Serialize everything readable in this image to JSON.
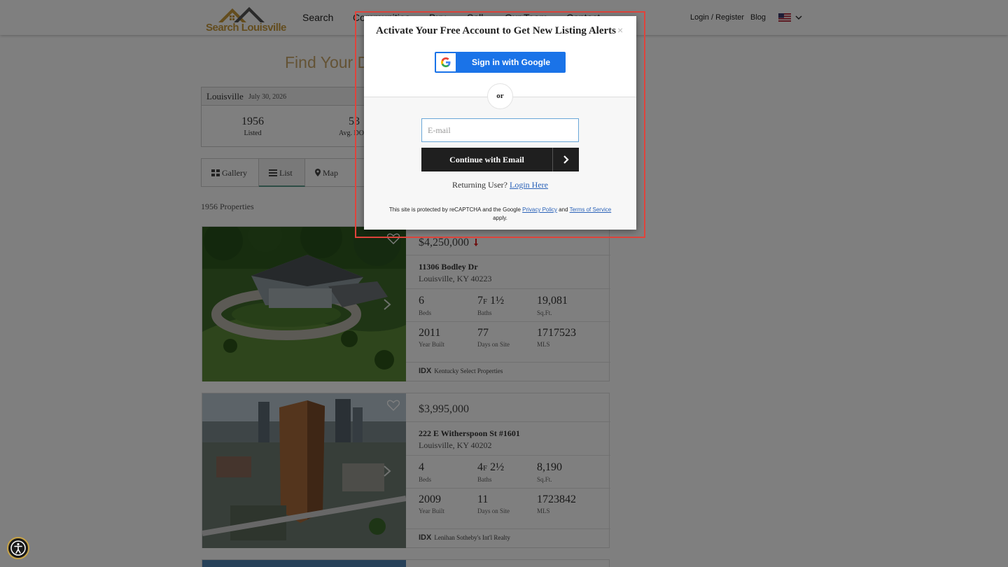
{
  "header": {
    "logo_text": "Search Louisville",
    "nav": [
      "Search",
      "Communities",
      "Buy",
      "Sell",
      "Our Team",
      "Contact"
    ],
    "login_register": "Login / Register",
    "blog": "Blog",
    "language_icon": "us-flag-icon"
  },
  "page": {
    "heading": "Find Your D",
    "stats": {
      "city": "Louisville",
      "date": "July 30, 2026",
      "listed_value": "1956",
      "listed_label": "Listed",
      "dom_value": "53",
      "dom_label": "Avg. DO"
    },
    "view_tabs": [
      "Gallery",
      "List",
      "Map"
    ],
    "property_count": "1956 Properties"
  },
  "listings": [
    {
      "price": "$4,250,000",
      "price_change_icon": "arrow-down-icon",
      "street": "11306 Bodley Dr",
      "city_state_zip": "Louisville, KY 40223",
      "beds": "6",
      "beds_label": "Beds",
      "baths_full": "7",
      "baths_full_suffix": "F",
      "baths_half": "1½",
      "baths_label": "Baths",
      "sqft": "19,081",
      "sqft_label": "Sq.Ft.",
      "year_built": "2011",
      "year_built_label": "Year Built",
      "days_on_site": "77",
      "days_on_site_label": "Days on Site",
      "mls": "1717523",
      "mls_label": "MLS",
      "idx_label": "IDX",
      "brokerage": "Kentucky Select Properties"
    },
    {
      "price": "$3,995,000",
      "street": "222 E Witherspoon St #1601",
      "city_state_zip": "Louisville, KY 40202",
      "beds": "4",
      "beds_label": "Beds",
      "baths_full": "4",
      "baths_full_suffix": "F",
      "baths_half": "2½",
      "baths_label": "Baths",
      "sqft": "8,190",
      "sqft_label": "Sq.Ft.",
      "year_built": "2009",
      "year_built_label": "Year Built",
      "days_on_site": "11",
      "days_on_site_label": "Days on Site",
      "mls": "1723842",
      "mls_label": "MLS",
      "idx_label": "IDX",
      "brokerage": "Lenihan Sotheby's Int'l Realty"
    }
  ],
  "modal": {
    "title": "Activate Your Free Account to Get New Listing Alerts",
    "close": "×",
    "google_button": "Sign in with Google",
    "or": "or",
    "email_placeholder": "E-mail",
    "email_value": "",
    "continue_button": "Continue with Email",
    "returning_text": "Returning User?",
    "login_link": "Login Here",
    "legal_pre": "This site is protected by reCAPTCHA and the Google",
    "privacy_link": "Privacy Policy",
    "legal_and": "and",
    "terms_link": "Terms of Service",
    "legal_post": "apply."
  },
  "colors": {
    "accent_gold": "#c8a66a",
    "google_blue": "#1a73e8",
    "highlight_red": "#e0443c",
    "button_dark": "#1f1f1f"
  }
}
